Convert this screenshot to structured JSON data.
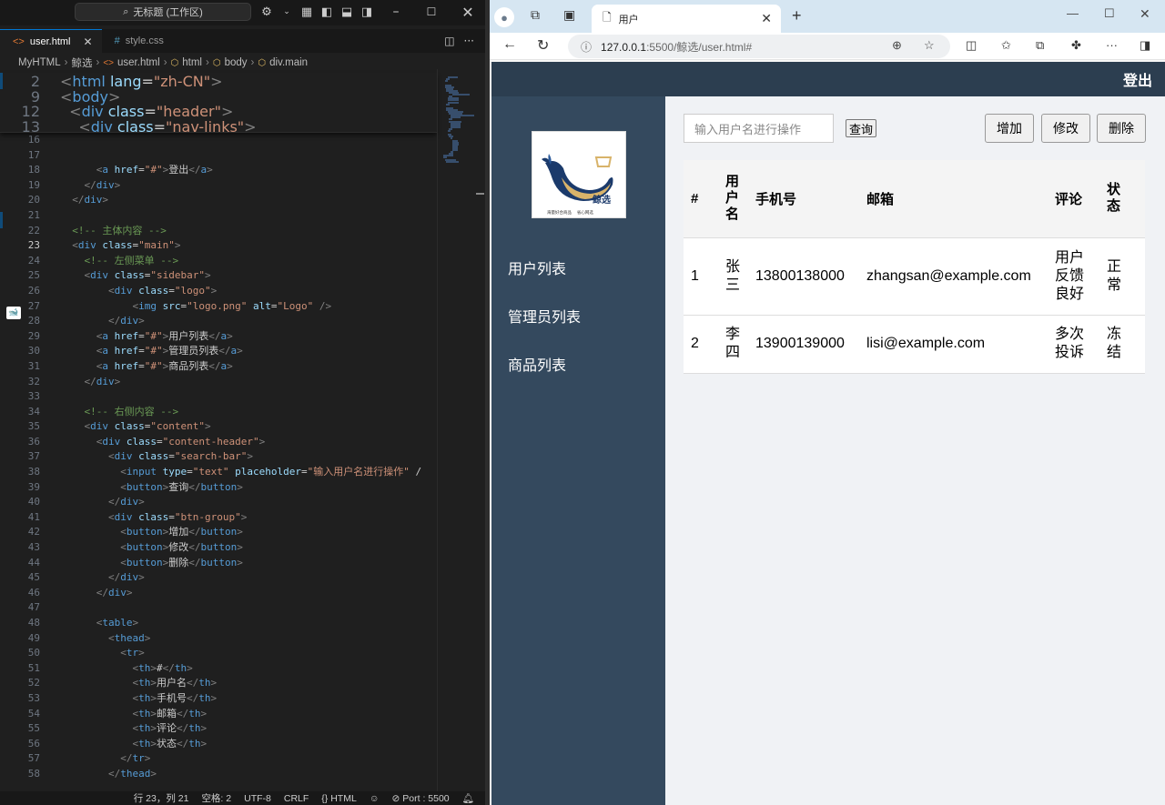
{
  "vscode": {
    "command_center": "无标题 (工作区)",
    "tabs": [
      {
        "label": "user.html",
        "icon": "<>",
        "active": true
      },
      {
        "label": "style.css",
        "icon": "#",
        "active": false
      }
    ],
    "breadcrumbs": [
      "MyHTML",
      "鲸选",
      "user.html",
      "html",
      "body",
      "div.main"
    ],
    "sticky_lines": [
      {
        "num": "2",
        "code": "<html lang=\"zh-CN\">"
      },
      {
        "num": "9",
        "code": "<body>"
      },
      {
        "num": "12",
        "code": "  <div class=\"header\">"
      },
      {
        "num": "13",
        "code": "    <div class=\"nav-links\">"
      }
    ],
    "lines": [
      {
        "num": "16",
        "code": ""
      },
      {
        "num": "17",
        "code": ""
      },
      {
        "num": "18",
        "code": "      <a href=\"#\">登出</a>"
      },
      {
        "num": "19",
        "code": "    </div>"
      },
      {
        "num": "20",
        "code": "  </div>"
      },
      {
        "num": "21",
        "code": ""
      },
      {
        "num": "22",
        "code": "  <!-- 主体内容 -->"
      },
      {
        "num": "23",
        "code": "  <div class=\"main\">"
      },
      {
        "num": "24",
        "code": "    <!-- 左侧菜单 -->"
      },
      {
        "num": "25",
        "code": "    <div class=\"sidebar\">"
      },
      {
        "num": "26",
        "code": "        <div class=\"logo\">"
      },
      {
        "num": "27",
        "code": "            <img src=\"logo.png\" alt=\"Logo\" />"
      },
      {
        "num": "28",
        "code": "        </div>"
      },
      {
        "num": "29",
        "code": "      <a href=\"#\">用户列表</a>"
      },
      {
        "num": "30",
        "code": "      <a href=\"#\">管理员列表</a>"
      },
      {
        "num": "31",
        "code": "      <a href=\"#\">商品列表</a>"
      },
      {
        "num": "32",
        "code": "    </div>"
      },
      {
        "num": "33",
        "code": ""
      },
      {
        "num": "34",
        "code": "    <!-- 右侧内容 -->"
      },
      {
        "num": "35",
        "code": "    <div class=\"content\">"
      },
      {
        "num": "36",
        "code": "      <div class=\"content-header\">"
      },
      {
        "num": "37",
        "code": "        <div class=\"search-bar\">"
      },
      {
        "num": "38",
        "code": "          <input type=\"text\" placeholder=\"输入用户名进行操作\" /"
      },
      {
        "num": "39",
        "code": "          <button>查询</button>"
      },
      {
        "num": "40",
        "code": "        </div>"
      },
      {
        "num": "41",
        "code": "        <div class=\"btn-group\">"
      },
      {
        "num": "42",
        "code": "          <button>增加</button>"
      },
      {
        "num": "43",
        "code": "          <button>修改</button>"
      },
      {
        "num": "44",
        "code": "          <button>删除</button>"
      },
      {
        "num": "45",
        "code": "        </div>"
      },
      {
        "num": "46",
        "code": "      </div>"
      },
      {
        "num": "47",
        "code": ""
      },
      {
        "num": "48",
        "code": "      <table>"
      },
      {
        "num": "49",
        "code": "        <thead>"
      },
      {
        "num": "50",
        "code": "          <tr>"
      },
      {
        "num": "51",
        "code": "            <th>#</th>"
      },
      {
        "num": "52",
        "code": "            <th>用户名</th>"
      },
      {
        "num": "53",
        "code": "            <th>手机号</th>"
      },
      {
        "num": "54",
        "code": "            <th>邮箱</th>"
      },
      {
        "num": "55",
        "code": "            <th>评论</th>"
      },
      {
        "num": "56",
        "code": "            <th>状态</th>"
      },
      {
        "num": "57",
        "code": "          </tr>"
      },
      {
        "num": "58",
        "code": "        </thead>"
      }
    ],
    "current_line": "23",
    "status": {
      "position": "行 23，列 21",
      "spaces": "空格: 2",
      "encoding": "UTF-8",
      "eol": "CRLF",
      "language": "{} HTML",
      "port": "Port : 5500"
    }
  },
  "browser": {
    "tab_title": "用户",
    "url_host": "127.0.0.1",
    "url_rest": ":5500/鲸选/user.html#"
  },
  "page": {
    "logout": "登出",
    "logo_brand": "鲸选",
    "logo_tagline": "海量好合商品　 省心网选",
    "nav": [
      "用户列表",
      "管理员列表",
      "商品列表"
    ],
    "search_placeholder": "输入用户名进行操作",
    "query_btn": "查询",
    "add_btn": "增加",
    "edit_btn": "修改",
    "delete_btn": "删除",
    "table": {
      "headers": [
        "#",
        "用户名",
        "手机号",
        "邮箱",
        "评论",
        "状态"
      ],
      "rows": [
        [
          "1",
          "张三",
          "13800138000",
          "zhangsan@example.com",
          "用户反馈良好",
          "正常"
        ],
        [
          "2",
          "李四",
          "13900139000",
          "lisi@example.com",
          "多次投诉",
          "冻结"
        ]
      ]
    }
  },
  "colors": {
    "header": "#2c3e50",
    "sidebar": "#34495e",
    "content_bg": "#f0f2f5",
    "vscode_bg": "#1f1f1f",
    "accent": "#0078d4"
  }
}
